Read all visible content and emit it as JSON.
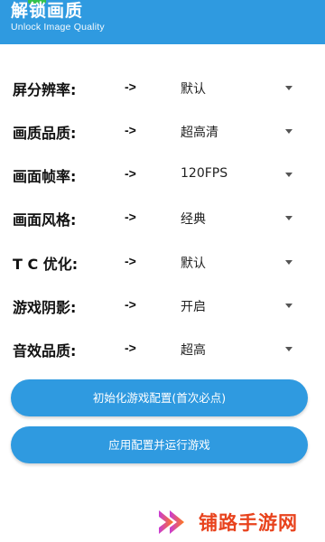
{
  "header": {
    "title": "解锁画质",
    "subtitle": "Unlock Image Quality",
    "bg_color": "#2f9ae0"
  },
  "settings": [
    {
      "label": "屏分辨率:",
      "arrow": "->",
      "value": "默认"
    },
    {
      "label": "画质品质:",
      "arrow": "->",
      "value": "超高清"
    },
    {
      "label": "画面帧率:",
      "arrow": "->",
      "value": "120FPS"
    },
    {
      "label": "画面风格:",
      "arrow": "->",
      "value": "经典"
    },
    {
      "label": "T C 优化:",
      "arrow": "->",
      "value": "默认"
    },
    {
      "label": "游戏阴影:",
      "arrow": "->",
      "value": "开启"
    },
    {
      "label": "音效品质:",
      "arrow": "->",
      "value": "超高"
    }
  ],
  "buttons": {
    "init_label": "初始化游戏配置(首次必点)",
    "apply_label": "应用配置并运行游戏"
  },
  "watermark": {
    "text": "铺路手游网",
    "color": "#e8431d",
    "icon": "play-chevron-logo-icon"
  }
}
